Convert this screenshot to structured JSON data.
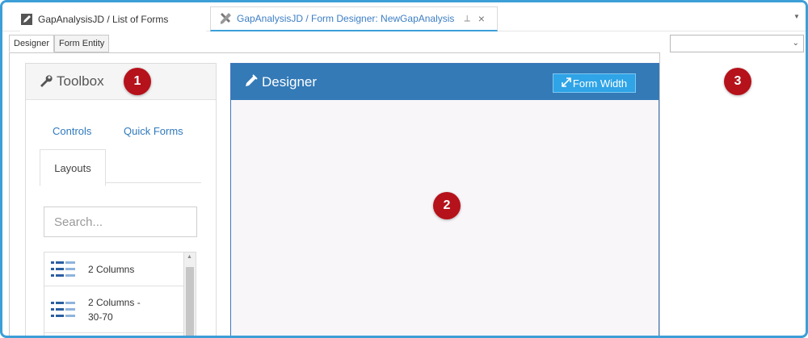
{
  "doc_tabs": [
    {
      "label": "GapAnalysisJD  / List of Forms",
      "icon": "edit-form-icon"
    },
    {
      "label": "GapAnalysisJD  / Form Designer: NewGapAnalysis",
      "icon": "tools-icon",
      "pin": "⟂",
      "close": "×"
    }
  ],
  "sub_tabs": [
    "Designer",
    "Form Entity"
  ],
  "right_select": {
    "value": ""
  },
  "toolbox": {
    "title": "Toolbox",
    "tabs": [
      "Controls",
      "Quick Forms",
      "Layouts"
    ],
    "search_placeholder": "Search...",
    "layouts": [
      {
        "label": "2 Columns",
        "icon": "columns-icon"
      },
      {
        "label": "2 Columns -\n30-70",
        "icon": "columns-icon"
      }
    ]
  },
  "designer": {
    "title": "Designer",
    "form_width_label": "Form Width"
  },
  "markers": [
    "1",
    "2",
    "3"
  ],
  "colors": {
    "accent": "#3c9fd7",
    "designer_header": "#337ab7",
    "form_width_btn": "#2fa4e7",
    "marker": "#b5121b",
    "link": "#2f79bd"
  }
}
